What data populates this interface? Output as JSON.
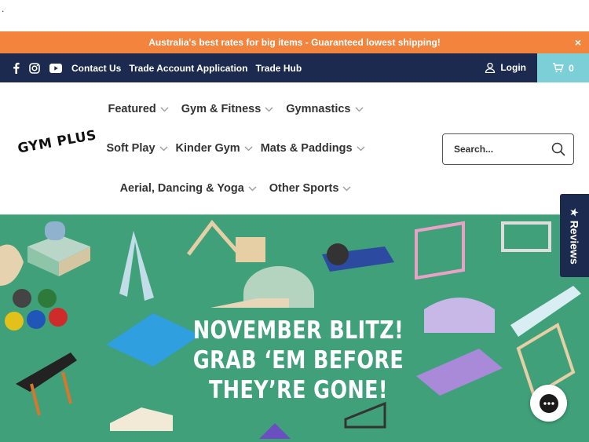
{
  "stray_dot": ".",
  "announcement": {
    "text": "Australia's best rates for big items - Guaranteed lowest shipping!",
    "close": "×"
  },
  "topbar": {
    "links": [
      "Contact Us",
      "Trade Account Application",
      "Trade Hub"
    ],
    "login": "Login",
    "cart_count": "0"
  },
  "logo": {
    "text": "GYM PLUS"
  },
  "nav": {
    "row1": [
      "Featured",
      "Gym & Fitness",
      "Gymnastics"
    ],
    "row2": [
      "Soft Play",
      "Kinder Gym",
      "Mats & Paddings"
    ],
    "row3": [
      "Aerial, Dancing & Yoga",
      "Other Sports"
    ]
  },
  "search": {
    "placeholder": "Search..."
  },
  "hero": {
    "line1": "NOVEMBER BLITZ!",
    "line2": "GRAB ‘EM BEFORE",
    "line3": "THEY’RE GONE!"
  },
  "reviews_tab": "★ Reviews",
  "colors": {
    "announce": "#f3843e",
    "topbar": "#1b2a4e",
    "cart": "#7ccfd6",
    "hero": "#3fa07a"
  }
}
